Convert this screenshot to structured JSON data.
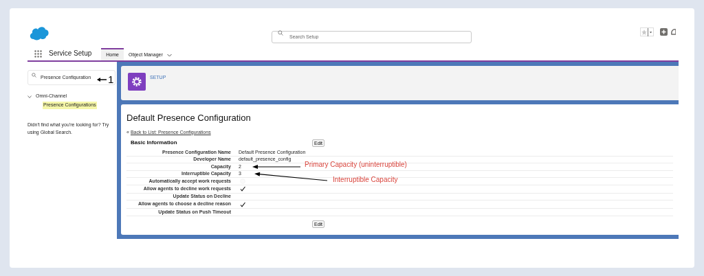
{
  "header": {
    "search": {
      "placeholder": "Search Setup"
    }
  },
  "nav": {
    "app_name": "Service Setup",
    "tabs": [
      {
        "label": "Home",
        "selected": true,
        "has_menu": false
      },
      {
        "label": "Object Manager",
        "selected": false,
        "has_menu": true
      }
    ]
  },
  "sidebar": {
    "quick_find": {
      "value": "Presence Configuration",
      "annotation": "1"
    },
    "tree": [
      {
        "label": "Omni-Channel",
        "expanded": true,
        "children": [
          {
            "label": "Presence Configurations",
            "highlighted": true
          }
        ]
      }
    ],
    "help_text": "Didn't find what you're looking for? Try using Global Search."
  },
  "setup_header": {
    "label": "SETUP"
  },
  "detail": {
    "title": "Default Presence Configuration",
    "back_mark": "«",
    "back_link": "Back to List: Presence Configurations",
    "section_title": "Basic Information",
    "edit_buttons": [
      "Edit",
      "Edit"
    ],
    "fields": [
      {
        "label": "Presence Configuration Name",
        "kind": "text",
        "value": "Default Presence Configuration"
      },
      {
        "label": "Developer Name",
        "kind": "text",
        "value": "default_presence_config"
      },
      {
        "label": "Capacity",
        "kind": "text",
        "value": "2",
        "annotation": "Primary Capacity (uninterruptible)"
      },
      {
        "label": "Interruptible Capacity",
        "kind": "text",
        "value": "3",
        "annotation": "Interruptible Capacity"
      },
      {
        "label": "Automatically accept work requests",
        "kind": "checkbox",
        "checked": false
      },
      {
        "label": "Allow agents to decline work requests",
        "kind": "checkbox",
        "checked": true
      },
      {
        "label": "Update Status on Decline",
        "kind": "text"
      },
      {
        "label": "Allow agents to choose a decline reason",
        "kind": "checkbox",
        "checked": true
      },
      {
        "label": "Update Status on Push Timeout",
        "kind": "text"
      }
    ]
  }
}
